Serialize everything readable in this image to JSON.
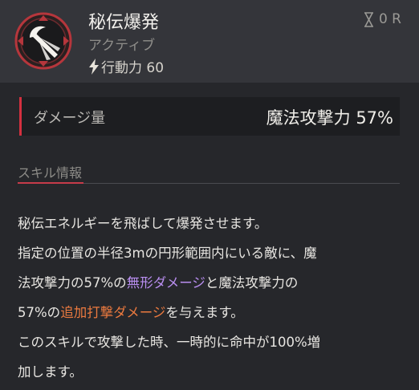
{
  "skill": {
    "name": "秘伝爆発",
    "type": "アクティブ",
    "cost_label": "行動力 60",
    "cooldown": "0 R",
    "icon": "comet-burst-icon"
  },
  "damage": {
    "label": "ダメージ量",
    "value": "魔法攻撃力 57%"
  },
  "info": {
    "title": "スキル情報",
    "lines": [
      "秘伝エネルギーを飛ばして爆発させます。",
      "指定の位置の半径3mの円形範囲内にいる敵に、魔",
      "法攻撃力の57%の",
      "無形ダメージ",
      "と魔法攻撃力の",
      "57%の",
      "追加打撃ダメージ",
      "を与えます。",
      "このスキルで攻撃した時、一時的に命中が100%増",
      "加します。"
    ]
  },
  "colors": {
    "accent_red": "#d3303f",
    "keyword_purple": "#b98ef0",
    "keyword_orange": "#ec7a3f"
  }
}
